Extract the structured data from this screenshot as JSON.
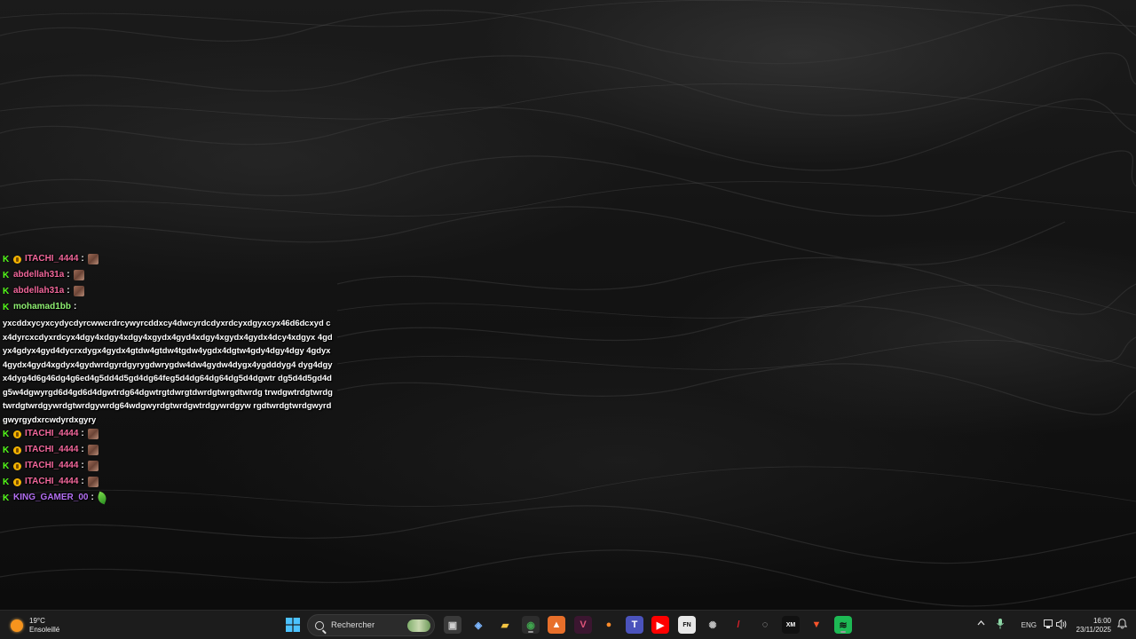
{
  "chat": {
    "messages": [
      {
        "user": "ITACHI_4444",
        "color": "#f2679b",
        "coin": true,
        "emote": "face"
      },
      {
        "user": "abdellah31a",
        "color": "#f2679b",
        "coin": false,
        "emote": "face"
      },
      {
        "user": "abdellah31a",
        "color": "#f2679b",
        "coin": false,
        "emote": "face"
      },
      {
        "user": "mohamad1bb",
        "color": "#8ff072",
        "coin": false,
        "emote": "none",
        "text": "yxcddxycyxcydycdyrcwwcrdrcywyrcddxcy4dwcyrdcdyxrdcyxdgyxcyx46d6dcxyd cx4dyrcxcdyxrdcyx4dgy4xdgy4xdgy4xgydx4gyd4xdgy4xgydx4gydx4dcy4xdgyx 4gdyx4gdyx4gyd4dycrxdygx4gydx4gtdw4gtdw4tgdw4ygdx4dgtw4gdy4dgy4dgy 4gdyx4gydx4gyd4xgdyx4gydwrdgyrdgyrygdwrygdw4dw4gydw4dygx4ygdddyg4 dyg4dgyx4dyg4d6g46dg4g6ed4g5dd4d5gd4dg64feg5d4dg64dg64dg5d4dgwtr dg5d4d5gd4dg5w4dgwyrgd6d4gd6d4dgwtrdg64dgwtrgtdwrgtdwrdgtwrgdtwrdg trwdgwtrdgtwrdgtwrdgtwrdgywrdgtwrdgywrdg64wdgwyrdgtwrdgwtrdgywrdgyw rgdtwrdgtwrdgwyrdgwyrgydxrcwdyrdxgyry"
      },
      {
        "user": "ITACHI_4444",
        "color": "#f2679b",
        "coin": true,
        "emote": "face"
      },
      {
        "user": "ITACHI_4444",
        "color": "#f2679b",
        "coin": true,
        "emote": "face"
      },
      {
        "user": "ITACHI_4444",
        "color": "#f2679b",
        "coin": true,
        "emote": "face"
      },
      {
        "user": "ITACHI_4444",
        "color": "#f2679b",
        "coin": true,
        "emote": "face"
      },
      {
        "user": "KING_GAMER_00",
        "color": "#b36ff2",
        "coin": false,
        "emote": "leaf"
      }
    ]
  },
  "taskbar": {
    "weather": {
      "temp": "19°C",
      "condition": "Ensoleillé"
    },
    "search_placeholder": "Rechercher",
    "apps": [
      {
        "name": "task-view-icon",
        "glyph": "▣",
        "bg": "#3a3a3a",
        "fg": "#cfcfcf",
        "active": false
      },
      {
        "name": "copilot-icon",
        "glyph": "◈",
        "bg": "transparent",
        "fg": "#7db7ff",
        "active": false
      },
      {
        "name": "file-explorer-icon",
        "glyph": "▰",
        "bg": "transparent",
        "fg": "#f4c542",
        "active": false
      },
      {
        "name": "chrome-icon",
        "glyph": "◉",
        "bg": "#2d2d2d",
        "fg": "#3fa34d",
        "active": true
      },
      {
        "name": "app-orange-icon",
        "glyph": "▲",
        "bg": "#e86f2a",
        "fg": "#fff",
        "active": false
      },
      {
        "name": "app-v-icon",
        "glyph": "V",
        "bg": "#3b1630",
        "fg": "#e0557a",
        "active": false
      },
      {
        "name": "firefox-icon",
        "glyph": "●",
        "bg": "transparent",
        "fg": "#ff8c2a",
        "active": false
      },
      {
        "name": "teams-icon",
        "glyph": "T",
        "bg": "#4b53bc",
        "fg": "#fff",
        "active": false
      },
      {
        "name": "youtube-icon",
        "glyph": "▶",
        "bg": "#ff0000",
        "fg": "#fff",
        "active": false
      },
      {
        "name": "app-fn-icon",
        "glyph": "FN",
        "bg": "#e8e8e8",
        "fg": "#111",
        "active": false
      },
      {
        "name": "app-gear-icon",
        "glyph": "✺",
        "bg": "transparent",
        "fg": "#bbb",
        "active": false
      },
      {
        "name": "app-red-icon",
        "glyph": "/",
        "bg": "transparent",
        "fg": "#e0202a",
        "active": false
      },
      {
        "name": "app-circle-icon",
        "glyph": "◌",
        "bg": "transparent",
        "fg": "#ccc",
        "active": false
      },
      {
        "name": "xm-icon",
        "glyph": "XM",
        "bg": "#111",
        "fg": "#fff",
        "active": false
      },
      {
        "name": "brave-icon",
        "glyph": "▼",
        "bg": "transparent",
        "fg": "#fb542b",
        "active": false
      },
      {
        "name": "spotify-icon",
        "glyph": "≋",
        "bg": "#1db954",
        "fg": "#111",
        "active": true
      }
    ],
    "tray": {
      "language": "ENG",
      "time": "16:00",
      "date": "23/11/2025"
    }
  }
}
